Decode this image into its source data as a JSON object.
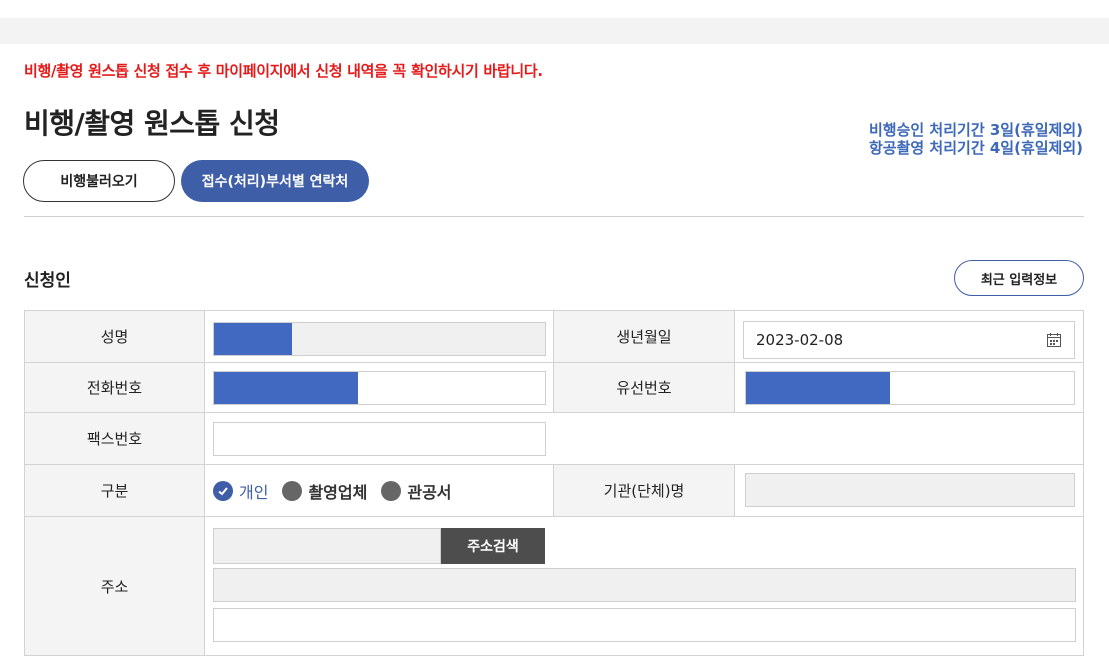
{
  "notice": "비행/촬영 원스톱 신청 접수 후 마이페이지에서 신청 내역을 꼭 확인하시기 바랍니다.",
  "title": "비행/촬영 원스톱 신청",
  "period": {
    "line1": "비행승인 처리기간 3일(휴일제외)",
    "line2": "항공촬영 처리기간 4일(휴일제외)"
  },
  "buttons": {
    "load_flight": "비행불러오기",
    "contacts": "접수(처리)부서별 연락처",
    "recent_info": "최근 입력정보",
    "address_search": "주소검색"
  },
  "section": {
    "applicant": "신청인"
  },
  "form": {
    "name_label": "성명",
    "birth_label": "생년월일",
    "birth_value": "2023-02-08",
    "phone_label": "전화번호",
    "landline_label": "유선번호",
    "fax_label": "팩스번호",
    "type_label": "구분",
    "type_options": [
      "개인",
      "촬영업체",
      "관공서"
    ],
    "org_label": "기관(단체)명",
    "address_label": "주소"
  },
  "colors": {
    "accent": "#3f5ea8",
    "notice": "#e51b1b",
    "redaction": "#4169c1"
  }
}
